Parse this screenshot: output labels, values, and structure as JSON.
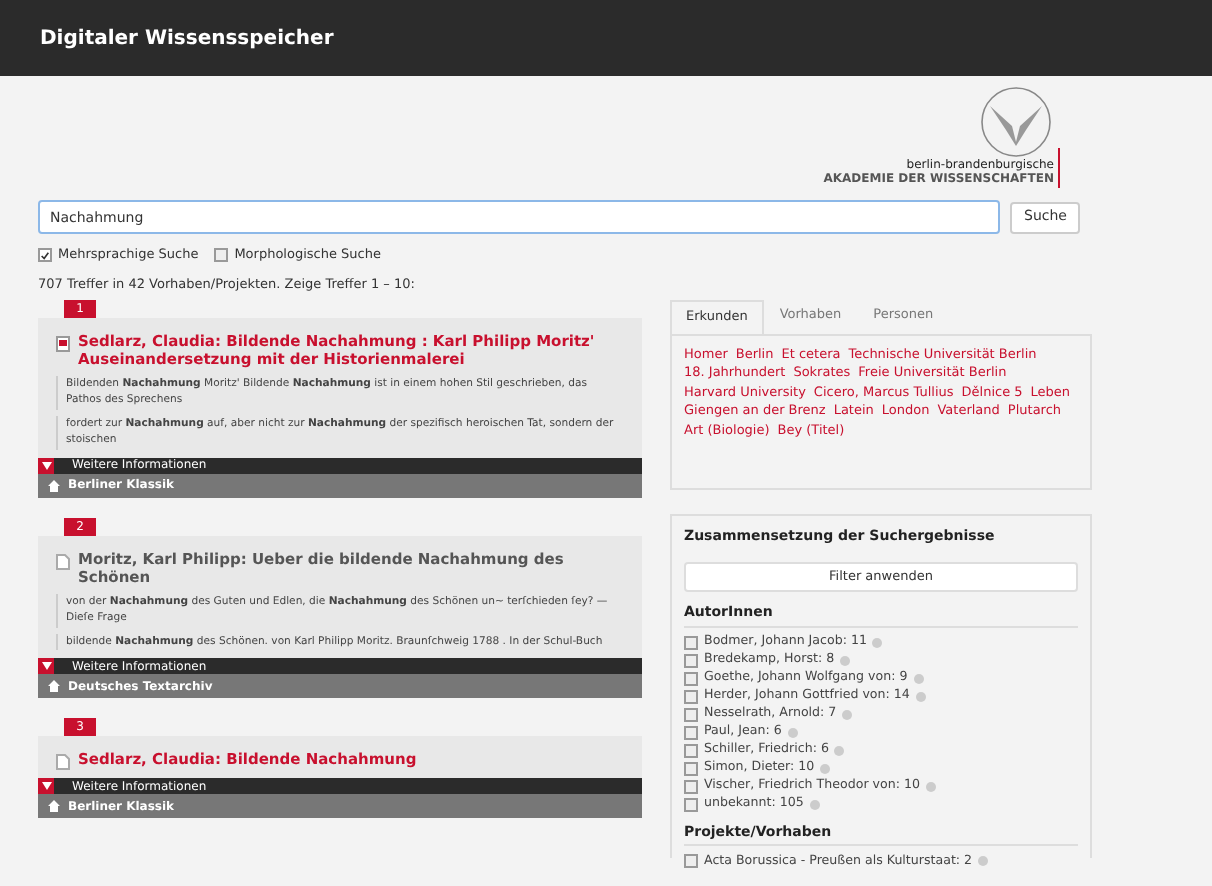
{
  "header": {
    "title": "Digitaler Wissensspeicher"
  },
  "logo": {
    "line_1": "berlin-brandenburgische",
    "line_2": "AKADEMIE DER WISSENSCHAFTEN"
  },
  "search": {
    "value": "Nachahmung",
    "button": "Suche"
  },
  "options": [
    {
      "label": "Mehrsprachige Suche",
      "checked": true
    },
    {
      "label": "Morphologische Suche",
      "checked": false
    }
  ],
  "summary": "707 Treffer in 42 Vorhaben/Projekten. Zeige Treffer 1 – 10:",
  "results": [
    {
      "number": "1",
      "kind": "pdf",
      "color": "#c8102e",
      "title": "Sedlarz, Claudia: Bildende Nachahmung : Karl Philipp Moritz' Auseinandersetzung mit der Historienmalerei",
      "snippets": [
        "Bildenden **Nachahmung** Moritz' Bildende **Nachahmung** ist in einem hohen Stil geschrieben, das Pathos des Sprechens",
        "fordert zur **Nachahmung** auf, aber nicht zur **Nachahmung** der spezifisch heroischen Tat, sondern der stoischen"
      ],
      "more": "Weitere Informationen",
      "source": "Berliner Klassik"
    },
    {
      "number": "2",
      "kind": "text",
      "color": "#555555",
      "title": "Moritz, Karl Philipp: Ueber die bildende Nachahmung des Schönen",
      "snippets": [
        "von der **Nachahmung** des Guten und Edlen, die **Nachahmung** des Schönen un~ terſchieden ſey? — Dieſe Frage",
        "bildende **Nachahmung** des Schönen. von Karl Philipp Moritz. Braunſchweig 1788 . In der Schul-Buch"
      ],
      "more": "Weitere Informationen",
      "source": "Deutsches Textarchiv"
    },
    {
      "number": "3",
      "kind": "text",
      "color": "#c8102e",
      "title": "Sedlarz, Claudia: Bildende Nachahmung",
      "more": "Weitere Informationen",
      "source": "Berliner Klassik"
    }
  ],
  "tabs": [
    {
      "label": "Erkunden",
      "selected": true
    },
    {
      "label": "Vorhaben",
      "selected": false
    },
    {
      "label": "Personen",
      "selected": false
    }
  ],
  "tags": [
    "Homer",
    "Berlin",
    "Et cetera",
    "Technische Universität Berlin",
    "18. Jahrhundert",
    "Sokrates",
    "Freie Universität Berlin",
    "Harvard University",
    "Cicero, Marcus Tullius",
    "Dělnice 5",
    "Leben",
    "Giengen an der Brenz",
    "Latein",
    "London",
    "Vaterland",
    "Plutarch",
    "Art (Biologie)",
    "Bey (Titel)"
  ],
  "facets": {
    "title": "Zusammensetzung der Suchergebnisse",
    "apply_button": "Filter anwenden",
    "groups": [
      {
        "title": "AutorInnen",
        "items": [
          {
            "label": "Bodmer, Johann Jacob: 11",
            "checked": false
          },
          {
            "label": "Bredekamp, Horst: 8",
            "checked": false
          },
          {
            "label": "Goethe, Johann Wolfgang von: 9",
            "checked": false
          },
          {
            "label": "Herder, Johann Gottfried von: 14",
            "checked": false
          },
          {
            "label": "Nesselrath, Arnold: 7",
            "checked": false
          },
          {
            "label": "Paul, Jean: 6",
            "checked": false
          },
          {
            "label": "Schiller, Friedrich: 6",
            "checked": false
          },
          {
            "label": "Simon, Dieter: 10",
            "checked": false
          },
          {
            "label": "Vischer, Friedrich Theodor von: 10",
            "checked": false
          },
          {
            "label": "unbekannt: 105",
            "checked": false
          }
        ]
      },
      {
        "title": "Projekte/Vorhaben",
        "items": [
          {
            "label": "Acta Borussica - Preußen als Kulturstaat: 2",
            "checked": false
          }
        ]
      }
    ]
  }
}
